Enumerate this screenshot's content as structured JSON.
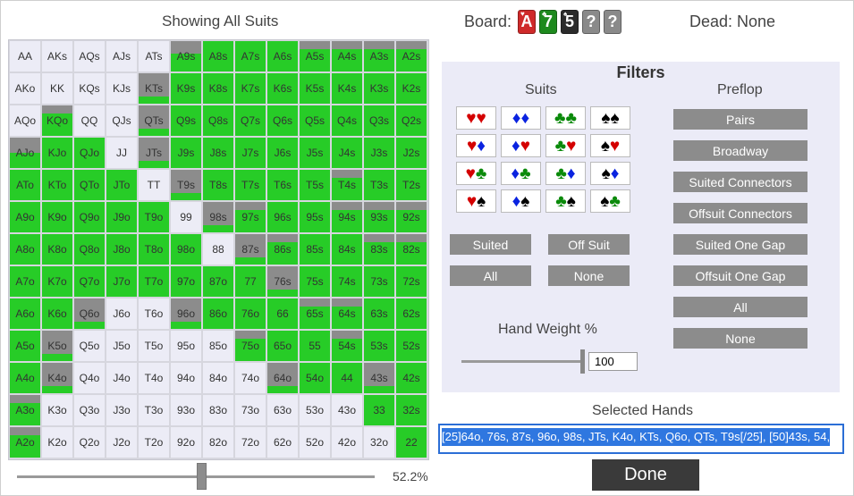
{
  "grid": {
    "title": "Showing All Suits",
    "slider_value": "52.2%",
    "cells": [
      [
        "AA",
        "AKs",
        "AQs",
        "AJs",
        "ATs",
        "A9s",
        "A8s",
        "A7s",
        "A6s",
        "A5s",
        "A4s",
        "A3s",
        "A2s"
      ],
      [
        "AKo",
        "KK",
        "KQs",
        "KJs",
        "KTs",
        "K9s",
        "K8s",
        "K7s",
        "K6s",
        "K5s",
        "K4s",
        "K3s",
        "K2s"
      ],
      [
        "AQo",
        "KQo",
        "QQ",
        "QJs",
        "QTs",
        "Q9s",
        "Q8s",
        "Q7s",
        "Q6s",
        "Q5s",
        "Q4s",
        "Q3s",
        "Q2s"
      ],
      [
        "AJo",
        "KJo",
        "QJo",
        "JJ",
        "JTs",
        "J9s",
        "J8s",
        "J7s",
        "J6s",
        "J5s",
        "J4s",
        "J3s",
        "J2s"
      ],
      [
        "ATo",
        "KTo",
        "QTo",
        "JTo",
        "TT",
        "T9s",
        "T8s",
        "T7s",
        "T6s",
        "T5s",
        "T4s",
        "T3s",
        "T2s"
      ],
      [
        "A9o",
        "K9o",
        "Q9o",
        "J9o",
        "T9o",
        "99",
        "98s",
        "97s",
        "96s",
        "95s",
        "94s",
        "93s",
        "92s"
      ],
      [
        "A8o",
        "K8o",
        "Q8o",
        "J8o",
        "T8o",
        "98o",
        "88",
        "87s",
        "86s",
        "85s",
        "84s",
        "83s",
        "82s"
      ],
      [
        "A7o",
        "K7o",
        "Q7o",
        "J7o",
        "T7o",
        "97o",
        "87o",
        "77",
        "76s",
        "75s",
        "74s",
        "73s",
        "72s"
      ],
      [
        "A6o",
        "K6o",
        "Q6o",
        "J6o",
        "T6o",
        "96o",
        "86o",
        "76o",
        "66",
        "65s",
        "64s",
        "63s",
        "62s"
      ],
      [
        "A5o",
        "K5o",
        "Q5o",
        "J5o",
        "T5o",
        "95o",
        "85o",
        "75o",
        "65o",
        "55",
        "54s",
        "53s",
        "52s"
      ],
      [
        "A4o",
        "K4o",
        "Q4o",
        "J4o",
        "T4o",
        "94o",
        "84o",
        "74o",
        "64o",
        "54o",
        "44",
        "43s",
        "42s"
      ],
      [
        "A3o",
        "K3o",
        "Q3o",
        "J3o",
        "T3o",
        "93o",
        "83o",
        "73o",
        "63o",
        "53o",
        "43o",
        "33",
        "32s"
      ],
      [
        "A2o",
        "K2o",
        "Q2o",
        "J2o",
        "T2o",
        "92o",
        "82o",
        "72o",
        "62o",
        "52o",
        "42o",
        "32o",
        "22"
      ]
    ],
    "weights": [
      [
        0,
        0,
        0,
        0,
        0,
        0.6,
        1,
        1,
        1,
        0.75,
        0.75,
        0.75,
        0.75
      ],
      [
        0,
        0,
        0,
        0,
        0.25,
        1,
        1,
        1,
        1,
        1,
        1,
        1,
        1
      ],
      [
        0,
        0.75,
        0,
        0,
        0.25,
        1,
        1,
        1,
        1,
        1,
        1,
        1,
        1
      ],
      [
        0.5,
        1,
        1,
        0,
        0.25,
        1,
        1,
        1,
        1,
        1,
        1,
        1,
        1
      ],
      [
        1,
        1,
        1,
        1,
        0,
        0.25,
        1,
        1,
        1,
        1,
        0.75,
        1,
        1
      ],
      [
        1,
        1,
        1,
        1,
        1,
        0,
        0.25,
        0.75,
        1,
        1,
        0.75,
        0.75,
        0.75
      ],
      [
        1,
        1,
        1,
        1,
        1,
        1,
        0,
        0.25,
        0.75,
        1,
        1,
        0.75,
        0.75
      ],
      [
        1,
        1,
        1,
        1,
        1,
        1,
        1,
        1,
        0.25,
        1,
        1,
        1,
        1
      ],
      [
        1,
        1,
        0.25,
        0,
        0,
        0.25,
        1,
        1,
        1,
        0.75,
        0.75,
        1,
        1
      ],
      [
        1,
        0.25,
        0,
        0,
        0,
        0,
        0,
        0.75,
        1,
        1,
        0.75,
        1,
        1
      ],
      [
        1,
        0.25,
        0,
        0,
        0,
        0,
        0,
        0,
        0.25,
        1,
        1,
        0.25,
        1
      ],
      [
        0.75,
        0,
        0,
        0,
        0,
        0,
        0,
        0,
        0,
        0,
        0,
        1,
        1
      ],
      [
        0.75,
        0,
        0,
        0,
        0,
        0,
        0,
        0,
        0,
        0,
        0,
        0,
        1
      ]
    ]
  },
  "board": {
    "label": "Board:",
    "cards": [
      {
        "rank": "A",
        "suit": "♥",
        "color": "#cf2a2a"
      },
      {
        "rank": "7",
        "suit": "♣",
        "color": "#1e8a1e"
      },
      {
        "rank": "5",
        "suit": "♠",
        "color": "#2b2b2b"
      },
      {
        "rank": "?",
        "suit": "",
        "color": "#8a8a8a"
      },
      {
        "rank": "?",
        "suit": "",
        "color": "#8a8a8a"
      }
    ],
    "dead_label": "Dead: None"
  },
  "filters": {
    "title": "Filters",
    "suits_title": "Suits",
    "preflop_title": "Preflop",
    "suit_combos": [
      [
        [
          "♥",
          "r"
        ],
        [
          "♥",
          "r"
        ]
      ],
      [
        [
          "♦",
          "b"
        ],
        [
          "♦",
          "b"
        ]
      ],
      [
        [
          "♣",
          "g"
        ],
        [
          "♣",
          "g"
        ]
      ],
      [
        [
          "♠",
          "k"
        ],
        [
          "♠",
          "k"
        ]
      ],
      [
        [
          "♥",
          "r"
        ],
        [
          "♦",
          "b"
        ]
      ],
      [
        [
          "♦",
          "b"
        ],
        [
          "♥",
          "r"
        ]
      ],
      [
        [
          "♣",
          "g"
        ],
        [
          "♥",
          "r"
        ]
      ],
      [
        [
          "♠",
          "k"
        ],
        [
          "♥",
          "r"
        ]
      ],
      [
        [
          "♥",
          "r"
        ],
        [
          "♣",
          "g"
        ]
      ],
      [
        [
          "♦",
          "b"
        ],
        [
          "♣",
          "g"
        ]
      ],
      [
        [
          "♣",
          "g"
        ],
        [
          "♦",
          "b"
        ]
      ],
      [
        [
          "♠",
          "k"
        ],
        [
          "♦",
          "b"
        ]
      ],
      [
        [
          "♥",
          "r"
        ],
        [
          "♠",
          "k"
        ]
      ],
      [
        [
          "♦",
          "b"
        ],
        [
          "♠",
          "k"
        ]
      ],
      [
        [
          "♣",
          "g"
        ],
        [
          "♠",
          "k"
        ]
      ],
      [
        [
          "♠",
          "k"
        ],
        [
          "♣",
          "g"
        ]
      ]
    ],
    "suited": "Suited",
    "off_suit": "Off Suit",
    "all": "All",
    "none": "None",
    "preflop": [
      "Pairs",
      "Broadway",
      "Suited Connectors",
      "Offsuit Connectors",
      "Suited One Gap",
      "Offsuit One Gap",
      "All",
      "None"
    ],
    "hand_weight_title": "Hand Weight %",
    "hand_weight_value": "100"
  },
  "selected": {
    "title": "Selected Hands",
    "value": "[25]64o, 76s, 87s, 96o, 98s, JTs, K4o, KTs, Q6o, QTs, T9s[/25], [50]43s, 54,"
  },
  "done_label": "Done",
  "colors": {
    "green": "#27cc27",
    "unselected": "#ececf6",
    "gray": "#8c8c8c"
  }
}
